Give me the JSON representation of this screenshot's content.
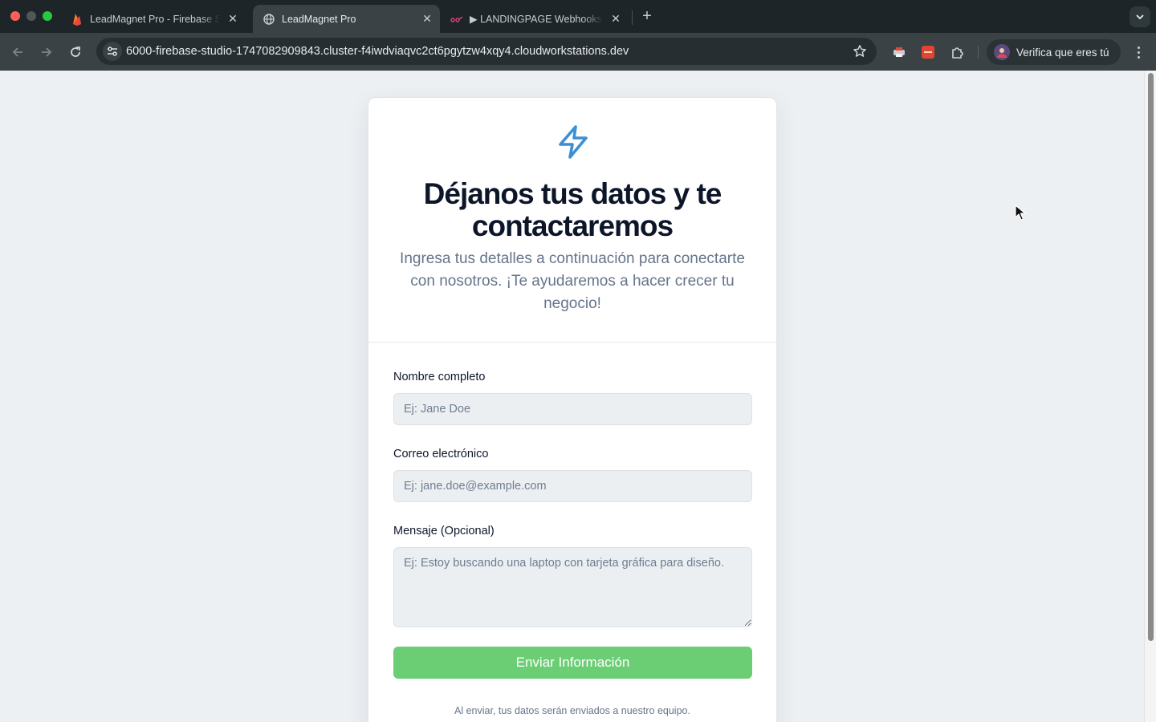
{
  "browser": {
    "tabs": [
      {
        "title": "LeadMagnet Pro - Firebase Studio",
        "icon": "firebase-icon",
        "active": false
      },
      {
        "title": "LeadMagnet Pro",
        "icon": "globe-icon",
        "active": true
      },
      {
        "title": "▶ LANDINGPAGE Webhooks",
        "icon": "webhook-icon",
        "active": false
      }
    ],
    "url": "6000-firebase-studio-1747082909843.cluster-f4iwdviaqvc2ct6pgytzw4xqy4.cloudworkstations.dev",
    "profile_label": "Verifica que eres tú"
  },
  "form": {
    "heading": "Déjanos tus datos y te contactaremos",
    "subheading": "Ingresa tus detalles a continuación para conectarte con nosotros. ¡Te ayudaremos a hacer crecer tu negocio!",
    "name_label": "Nombre completo",
    "name_placeholder": "Ej: Jane Doe",
    "email_label": "Correo electrónico",
    "email_placeholder": "Ej: jane.doe@example.com",
    "message_label": "Mensaje (Opcional)",
    "message_placeholder": "Ej: Estoy buscando una laptop con tarjeta gráfica para diseño.",
    "submit_label": "Enviar Información",
    "footnote": "Al enviar, tus datos serán enviados a nuestro equipo."
  },
  "colors": {
    "accent_icon": "#3b8fd4",
    "submit_button": "#6bce75",
    "heading_text": "#0d1629",
    "muted_text": "#66748a"
  }
}
